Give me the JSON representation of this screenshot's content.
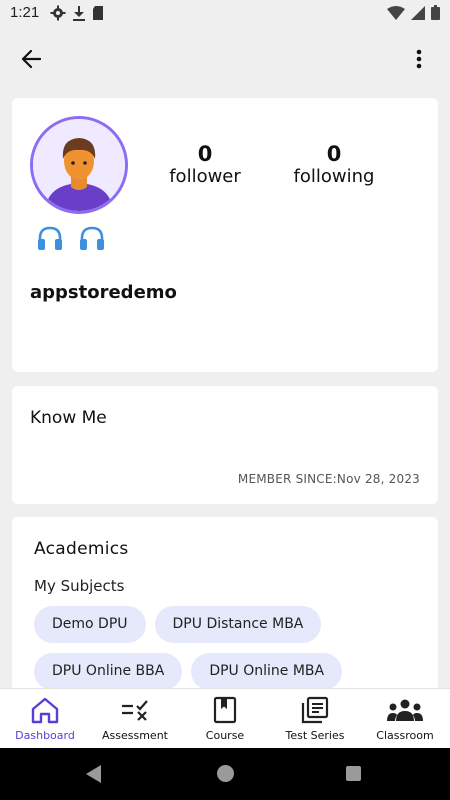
{
  "status_bar": {
    "time": "1:21",
    "icons_left": [
      "gear-icon",
      "download-icon",
      "sd-card-icon"
    ],
    "icons_right": [
      "wifi-icon",
      "signal-icon",
      "battery-icon"
    ]
  },
  "app_bar": {
    "back_icon": "arrow-left-icon",
    "menu_icon": "more-vertical-icon"
  },
  "profile": {
    "avatar": "avatar",
    "follower_count": "0",
    "follower_label": "follower",
    "following_count": "0",
    "following_label": "following",
    "badges": [
      "headphones-icon",
      "headphones-icon"
    ],
    "username": "appstoredemo"
  },
  "know_me": {
    "title": "Know Me",
    "member_since": "MEMBER SINCE:Nov 28, 2023"
  },
  "academics": {
    "title": "Academics",
    "subjects_label": "My Subjects",
    "subjects": [
      "Demo DPU",
      "DPU Distance MBA",
      "DPU Online BBA",
      "DPU Online MBA"
    ]
  },
  "bottom_nav": {
    "items": [
      {
        "label": "Dashboard",
        "icon": "home-icon",
        "active": true
      },
      {
        "label": "Assessment",
        "icon": "assessment-icon",
        "active": false
      },
      {
        "label": "Course",
        "icon": "book-icon",
        "active": false
      },
      {
        "label": "Test Series",
        "icon": "test-series-icon",
        "active": false
      },
      {
        "label": "Classroom",
        "icon": "classroom-icon",
        "active": false
      }
    ]
  },
  "colors": {
    "accent": "#5a3fd6",
    "avatar_ring": "#8b6cf2",
    "chip_bg": "#e6e9fb",
    "headphones": "#3d8fe0"
  }
}
